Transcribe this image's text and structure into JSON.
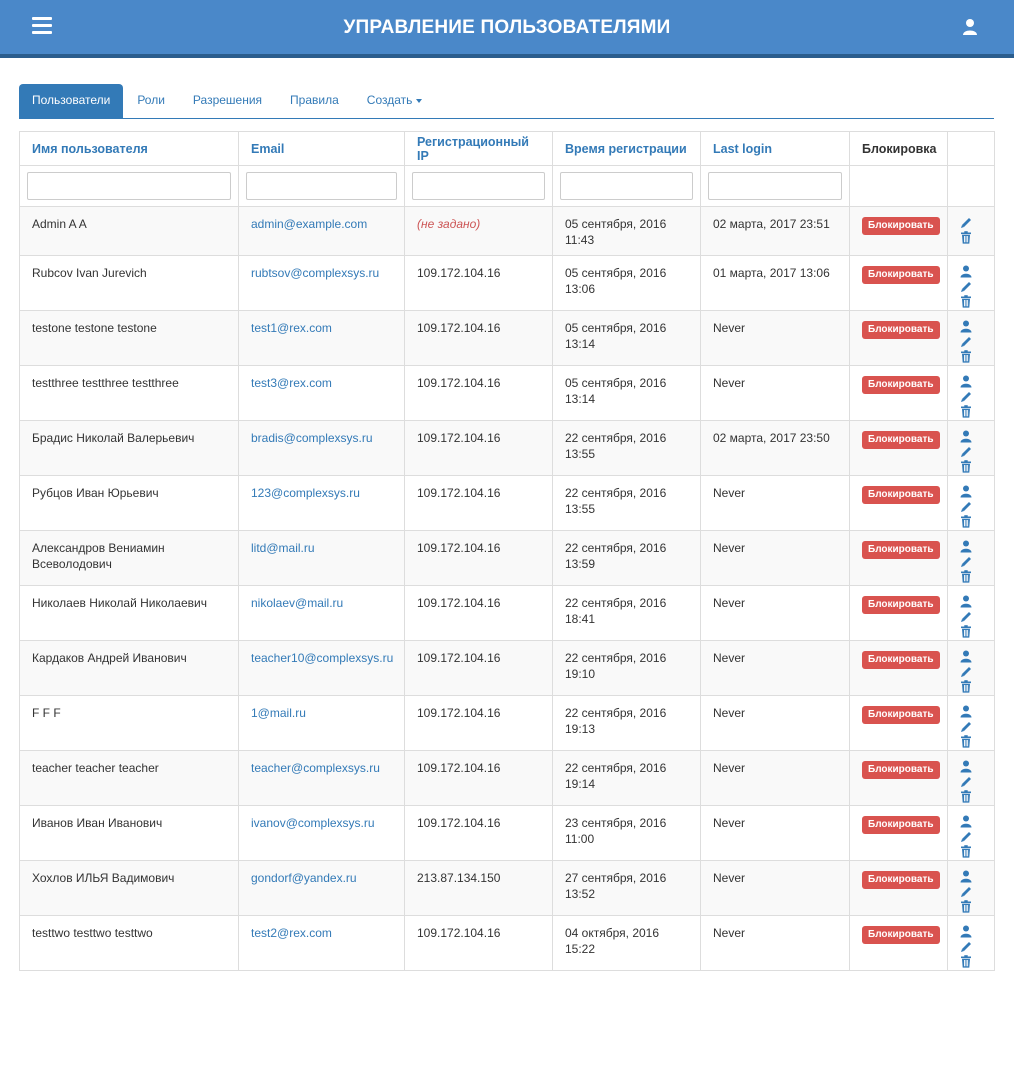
{
  "header": {
    "title": "УПРАВЛЕНИЕ ПОЛЬЗОВАТЕЛЯМИ",
    "menu_icon": "hamburger-icon",
    "user_icon": "user-icon"
  },
  "tabs": [
    {
      "label": "Пользователи",
      "active": true
    },
    {
      "label": "Роли"
    },
    {
      "label": "Разрешения"
    },
    {
      "label": "Правила"
    },
    {
      "label": "Создать",
      "dropdown": true
    }
  ],
  "table": {
    "columns": [
      "Имя пользователя",
      "Email",
      "Регистрационный IP",
      "Время регистрации",
      "Last login",
      "Блокировка",
      ""
    ],
    "block_label": "Блокировать",
    "not_set_label": "(не задано)",
    "rows": [
      {
        "name": "Admin A A",
        "email": "admin@example.com",
        "ip": "",
        "reg1": "05 сентября, 2016",
        "reg2": "11:43",
        "last": "02 марта, 2017 23:51",
        "view": false
      },
      {
        "name": "Rubcov Ivan Jurevich",
        "email": "rubtsov@complexsys.ru",
        "ip": "109.172.104.16",
        "reg1": "05 сентября, 2016",
        "reg2": "13:06",
        "last": "01 марта, 2017 13:06",
        "view": true
      },
      {
        "name": "testone testone testone",
        "email": "test1@rex.com",
        "ip": "109.172.104.16",
        "reg1": "05 сентября, 2016",
        "reg2": "13:14",
        "last": "Never",
        "view": true
      },
      {
        "name": "testthree testthree testthree",
        "email": "test3@rex.com",
        "ip": "109.172.104.16",
        "reg1": "05 сентября, 2016",
        "reg2": "13:14",
        "last": "Never",
        "view": true
      },
      {
        "name": "Брадис Николай Валерьевич",
        "email": "bradis@complexsys.ru",
        "ip": "109.172.104.16",
        "reg1": "22 сентября, 2016",
        "reg2": "13:55",
        "last": "02 марта, 2017 23:50",
        "view": true
      },
      {
        "name": "Рубцов Иван Юрьевич",
        "email": "123@complexsys.ru",
        "ip": "109.172.104.16",
        "reg1": "22 сентября, 2016",
        "reg2": "13:55",
        "last": "Never",
        "view": true
      },
      {
        "name": "Александров Вениамин Всеволодович",
        "email": "litd@mail.ru",
        "ip": "109.172.104.16",
        "reg1": "22 сентября, 2016",
        "reg2": "13:59",
        "last": "Never",
        "view": true
      },
      {
        "name": "Николаев Николай Николаевич",
        "email": "nikolaev@mail.ru",
        "ip": "109.172.104.16",
        "reg1": "22 сентября, 2016",
        "reg2": "18:41",
        "last": "Never",
        "view": true
      },
      {
        "name": "Кардаков Андрей Иванович",
        "email": "teacher10@complexsys.ru",
        "ip": "109.172.104.16",
        "reg1": "22 сентября, 2016",
        "reg2": "19:10",
        "last": "Never",
        "view": true
      },
      {
        "name": "F F F",
        "email": "1@mail.ru",
        "ip": "109.172.104.16",
        "reg1": "22 сентября, 2016",
        "reg2": "19:13",
        "last": "Never",
        "view": true
      },
      {
        "name": "teacher teacher teacher",
        "email": "teacher@complexsys.ru",
        "ip": "109.172.104.16",
        "reg1": "22 сентября, 2016",
        "reg2": "19:14",
        "last": "Never",
        "view": true
      },
      {
        "name": "Иванов Иван Иванович",
        "email": "ivanov@complexsys.ru",
        "ip": "109.172.104.16",
        "reg1": "23 сентября, 2016",
        "reg2": "11:00",
        "last": "Never",
        "view": true
      },
      {
        "name": "Хохлов ИЛЬЯ Вадимович",
        "email": "gondorf@yandex.ru",
        "ip": "213.87.134.150",
        "reg1": "27 сентября, 2016",
        "reg2": "13:52",
        "last": "Never",
        "view": true
      },
      {
        "name": "testtwo testtwo testtwo",
        "email": "test2@rex.com",
        "ip": "109.172.104.16",
        "reg1": "04 октября, 2016",
        "reg2": "15:22",
        "last": "Never",
        "view": true
      }
    ]
  },
  "colors": {
    "header_bg": "#4a88c9",
    "accent": "#337ab7",
    "danger": "#d9534f"
  }
}
